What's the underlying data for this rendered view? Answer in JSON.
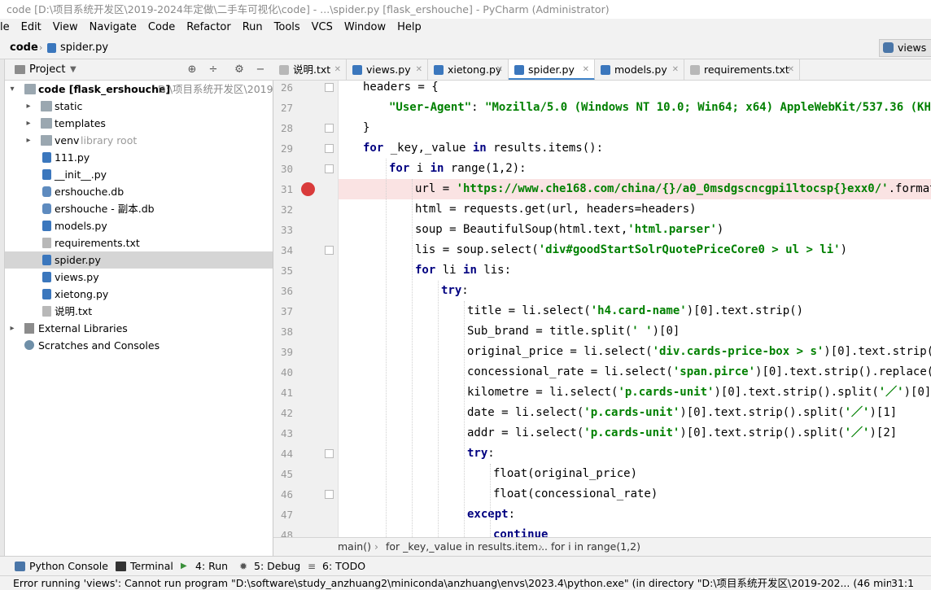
{
  "window": {
    "title": "code [D:\\项目系统开发区\\2019-2024年定做\\二手车可视化\\code] - ...\\spider.py [flask_ershouche] - PyCharm (Administrator)"
  },
  "menu": [
    "le",
    "Edit",
    "View",
    "Navigate",
    "Code",
    "Refactor",
    "Run",
    "Tools",
    "VCS",
    "Window",
    "Help"
  ],
  "nav": {
    "project": "code",
    "file": "spider.py",
    "run_config": "views"
  },
  "project_panel": {
    "title": "Project",
    "root_label": "code [flask_ershouche]",
    "root_path": "D:\\项目系统开发区\\2019-2",
    "items": [
      {
        "label": "static",
        "type": "folder",
        "arrow": "▸"
      },
      {
        "label": "templates",
        "type": "folder",
        "arrow": "▸"
      },
      {
        "label": "venv",
        "type": "folder",
        "arrow": "▸",
        "suffix": "library root"
      },
      {
        "label": "111.py",
        "type": "py"
      },
      {
        "label": "__init__.py",
        "type": "py"
      },
      {
        "label": "ershouche.db",
        "type": "db"
      },
      {
        "label": "ershouche - 副本.db",
        "type": "db"
      },
      {
        "label": "models.py",
        "type": "py"
      },
      {
        "label": "requirements.txt",
        "type": "txt"
      },
      {
        "label": "spider.py",
        "type": "py",
        "selected": true
      },
      {
        "label": "views.py",
        "type": "py"
      },
      {
        "label": "xietong.py",
        "type": "py"
      },
      {
        "label": "说明.txt",
        "type": "txt"
      }
    ],
    "external_libraries": "External Libraries",
    "scratches": "Scratches and Consoles"
  },
  "tabs": [
    {
      "label": "说明.txt",
      "type": "txt"
    },
    {
      "label": "views.py",
      "type": "py"
    },
    {
      "label": "xietong.py",
      "type": "py"
    },
    {
      "label": "spider.py",
      "type": "py",
      "active": true
    },
    {
      "label": "models.py",
      "type": "py"
    },
    {
      "label": "requirements.txt",
      "type": "txt"
    }
  ],
  "code": {
    "lines": [
      {
        "n": "26",
        "indent": 1,
        "segments": [
          {
            "t": "headers = {"
          }
        ]
      },
      {
        "n": "27",
        "indent": 2,
        "segments": [
          {
            "t": "\"User-Agent\"",
            "c": "str"
          },
          {
            "t": ": "
          },
          {
            "t": "\"Mozilla/5.0 (Windows NT 10.0; Win64; x64) AppleWebKit/537.36 (KHTML, ",
            "c": "str"
          }
        ]
      },
      {
        "n": "28",
        "indent": 1,
        "segments": [
          {
            "t": "}"
          }
        ]
      },
      {
        "n": "29",
        "indent": 1,
        "segments": [
          {
            "t": "for",
            "c": "kw"
          },
          {
            "t": " _key,_value "
          },
          {
            "t": "in",
            "c": "kw"
          },
          {
            "t": " results.items():"
          }
        ]
      },
      {
        "n": "30",
        "indent": 2,
        "segments": [
          {
            "t": "for",
            "c": "kw"
          },
          {
            "t": " i "
          },
          {
            "t": "in",
            "c": "kw"
          },
          {
            "t": " range(1,2):"
          }
        ]
      },
      {
        "n": "31",
        "indent": 3,
        "bp": true,
        "segments": [
          {
            "t": "url = "
          },
          {
            "t": "'https://www.che168.com/china/{}/a0_0msdgscncgpi1ltocsp{}exx0/'",
            "c": "str"
          },
          {
            "t": ".format(_va"
          }
        ]
      },
      {
        "n": "32",
        "indent": 3,
        "segments": [
          {
            "t": "html = requests.get(url, headers=headers)"
          }
        ]
      },
      {
        "n": "33",
        "indent": 3,
        "segments": [
          {
            "t": "soup = BeautifulSoup(html.text,"
          },
          {
            "t": "'html.parser'",
            "c": "str"
          },
          {
            "t": ")"
          }
        ]
      },
      {
        "n": "34",
        "indent": 3,
        "segments": [
          {
            "t": "lis = soup.select("
          },
          {
            "t": "'div#goodStartSolrQuotePriceCore0 > ul > li'",
            "c": "str"
          },
          {
            "t": ")"
          }
        ]
      },
      {
        "n": "35",
        "indent": 3,
        "segments": [
          {
            "t": "for",
            "c": "kw"
          },
          {
            "t": " li "
          },
          {
            "t": "in",
            "c": "kw"
          },
          {
            "t": " lis:"
          }
        ]
      },
      {
        "n": "36",
        "indent": 4,
        "segments": [
          {
            "t": "try",
            "c": "kw"
          },
          {
            "t": ":"
          }
        ]
      },
      {
        "n": "37",
        "indent": 5,
        "segments": [
          {
            "t": "title = li.select("
          },
          {
            "t": "'h4.card-name'",
            "c": "str"
          },
          {
            "t": ")[0].text.strip()"
          }
        ]
      },
      {
        "n": "38",
        "indent": 5,
        "segments": [
          {
            "t": "Sub_brand = title.split("
          },
          {
            "t": "' '",
            "c": "str"
          },
          {
            "t": ")[0]"
          }
        ]
      },
      {
        "n": "39",
        "indent": 5,
        "segments": [
          {
            "t": "original_price = li.select("
          },
          {
            "t": "'div.cards-price-box > s'",
            "c": "str"
          },
          {
            "t": ")[0].text.strip().re"
          }
        ]
      },
      {
        "n": "40",
        "indent": 5,
        "segments": [
          {
            "t": "concessional_rate = li.select("
          },
          {
            "t": "'span.pirce'",
            "c": "str"
          },
          {
            "t": ")[0].text.strip().replace("
          },
          {
            "t": "'万",
            "c": "str"
          }
        ]
      },
      {
        "n": "41",
        "indent": 5,
        "segments": [
          {
            "t": "kilometre = li.select("
          },
          {
            "t": "'p.cards-unit'",
            "c": "str"
          },
          {
            "t": ")[0].text.strip().split("
          },
          {
            "t": "'／'",
            "c": "str"
          },
          {
            "t": ")[0].rep"
          }
        ]
      },
      {
        "n": "42",
        "indent": 5,
        "segments": [
          {
            "t": "date = li.select("
          },
          {
            "t": "'p.cards-unit'",
            "c": "str"
          },
          {
            "t": ")[0].text.strip().split("
          },
          {
            "t": "'／'",
            "c": "str"
          },
          {
            "t": ")[1]"
          }
        ]
      },
      {
        "n": "43",
        "indent": 5,
        "segments": [
          {
            "t": "addr = li.select("
          },
          {
            "t": "'p.cards-unit'",
            "c": "str"
          },
          {
            "t": ")[0].text.strip().split("
          },
          {
            "t": "'／'",
            "c": "str"
          },
          {
            "t": ")[2]"
          }
        ]
      },
      {
        "n": "44",
        "indent": 5,
        "segments": [
          {
            "t": "try",
            "c": "kw"
          },
          {
            "t": ":"
          }
        ]
      },
      {
        "n": "45",
        "indent": 6,
        "segments": [
          {
            "t": "float(original_price)"
          }
        ]
      },
      {
        "n": "46",
        "indent": 6,
        "segments": [
          {
            "t": "float(concessional_rate)"
          }
        ]
      },
      {
        "n": "47",
        "indent": 5,
        "segments": [
          {
            "t": "except",
            "c": "kw"
          },
          {
            "t": ":"
          }
        ]
      },
      {
        "n": "48",
        "indent": 6,
        "segments": [
          {
            "t": "continue",
            "c": "kw"
          }
        ]
      }
    ]
  },
  "breadcrumbs": [
    "main()",
    "for _key,_value in results.item...",
    "for i in range(1,2)"
  ],
  "tool_windows": [
    "Python Console",
    "Terminal",
    "4: Run",
    "5: Debug",
    "6: TODO"
  ],
  "status": {
    "message": "Error running 'views': Cannot run program \"D:\\software\\study_anzhuang2\\miniconda\\anzhuang\\envs\\2023.4\\python.exe\" (in directory \"D:\\项目系统开发区\\2019-202... (46 minutes ago)",
    "position": "31:1"
  },
  "colors": {
    "keyword": "#000080",
    "string": "#008000",
    "breakpoint": "#d93b3b",
    "breakpoint_line": "#fae3e3",
    "active_tab": "#4083c9"
  }
}
